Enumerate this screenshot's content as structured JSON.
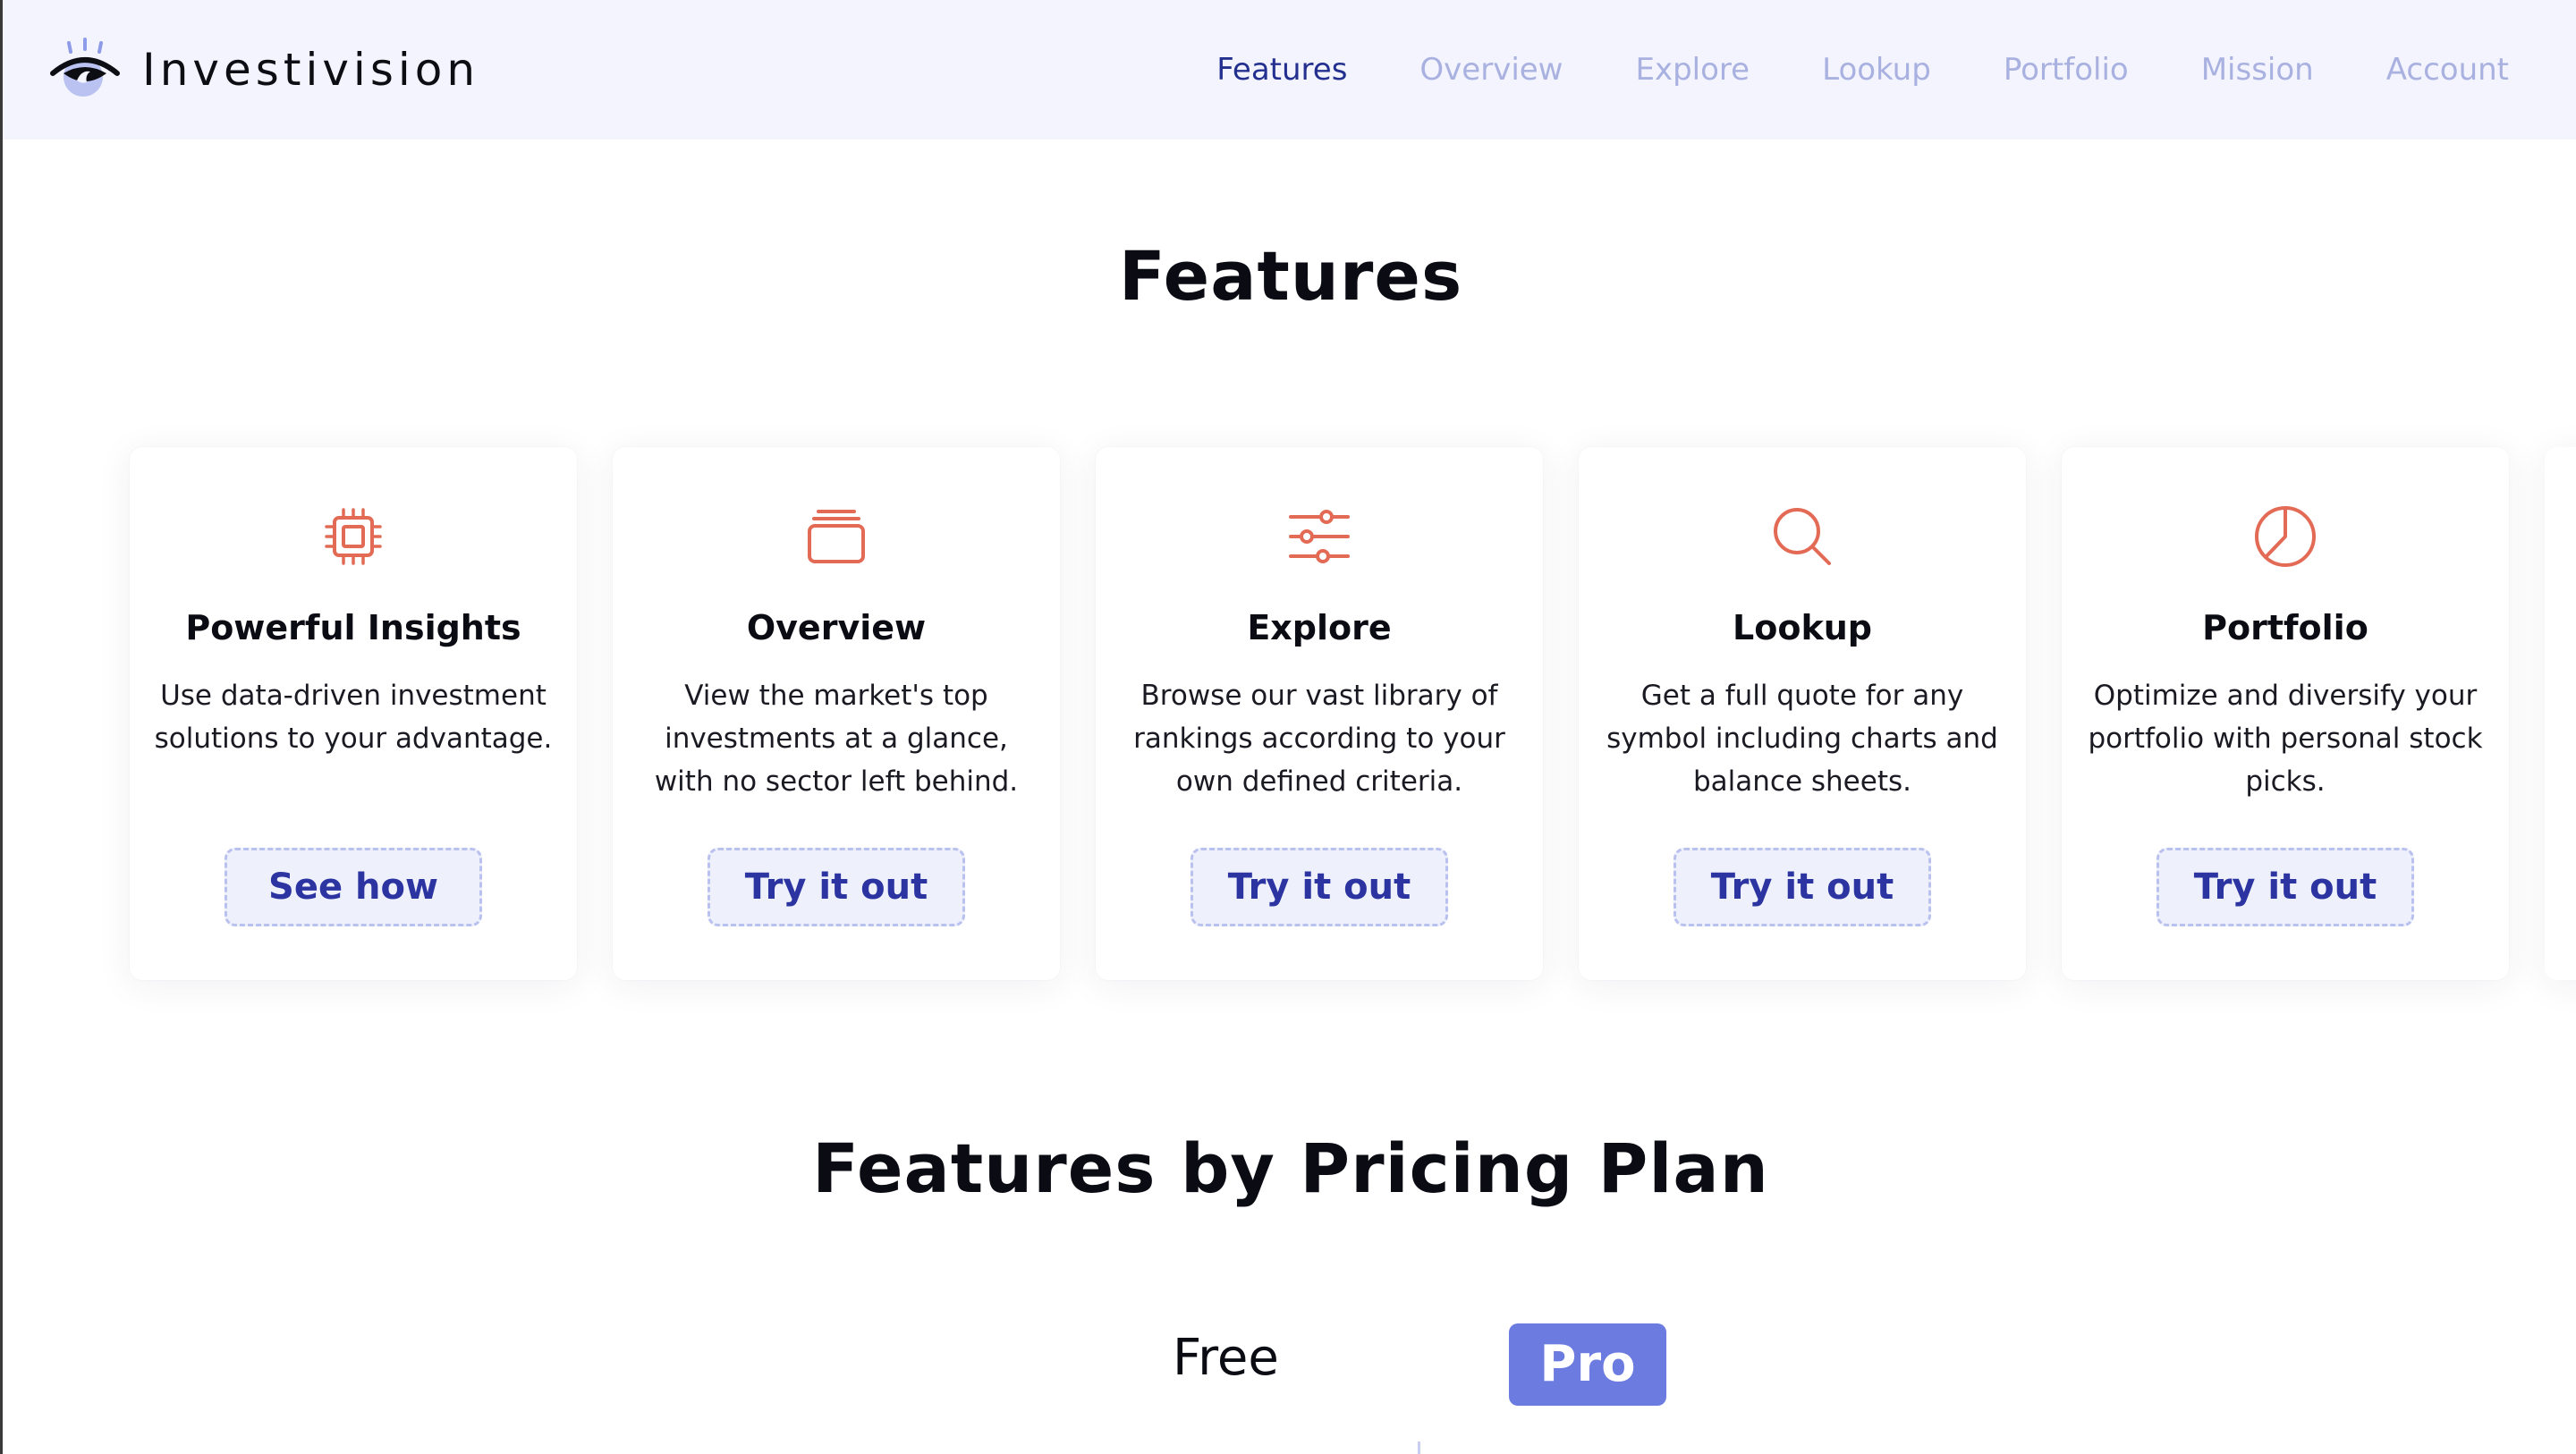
{
  "brand": {
    "name": "Investivision",
    "logo_icon": "eye-logo-icon"
  },
  "nav": {
    "items": [
      {
        "label": "Features",
        "active": true
      },
      {
        "label": "Overview",
        "active": false
      },
      {
        "label": "Explore",
        "active": false
      },
      {
        "label": "Lookup",
        "active": false
      },
      {
        "label": "Portfolio",
        "active": false
      },
      {
        "label": "Mission",
        "active": false
      },
      {
        "label": "Account",
        "active": false
      }
    ]
  },
  "features": {
    "title": "Features",
    "cards": [
      {
        "icon": "cpu-chip-icon",
        "title": "Powerful Insights",
        "description": "Use data-driven investment solutions to your advantage.",
        "button": "See how"
      },
      {
        "icon": "stacked-cards-icon",
        "title": "Overview",
        "description": "View the market's top investments at a glance, with no sector left behind.",
        "button": "Try it out"
      },
      {
        "icon": "sliders-icon",
        "title": "Explore",
        "description": "Browse our vast library of rankings according to your own defined criteria.",
        "button": "Try it out"
      },
      {
        "icon": "search-icon",
        "title": "Lookup",
        "description": "Get a full quote for any symbol including charts and balance sheets.",
        "button": "Try it out"
      },
      {
        "icon": "pie-chart-icon",
        "title": "Portfolio",
        "description": "Optimize and diversify your portfolio with personal stock picks.",
        "button": "Try it out"
      }
    ]
  },
  "pricing": {
    "title": "Features by Pricing Plan",
    "plans": {
      "free": "Free",
      "pro": "Pro"
    },
    "selected": "Pro"
  },
  "colors": {
    "header_bg": "#f3f4fd",
    "nav_active": "#24308f",
    "nav_inactive": "#a9b1e0",
    "icon_accent": "#e36b55",
    "button_text": "#2b34a0",
    "button_bg": "#eef0fb",
    "pro_bg": "#6b7be0"
  }
}
